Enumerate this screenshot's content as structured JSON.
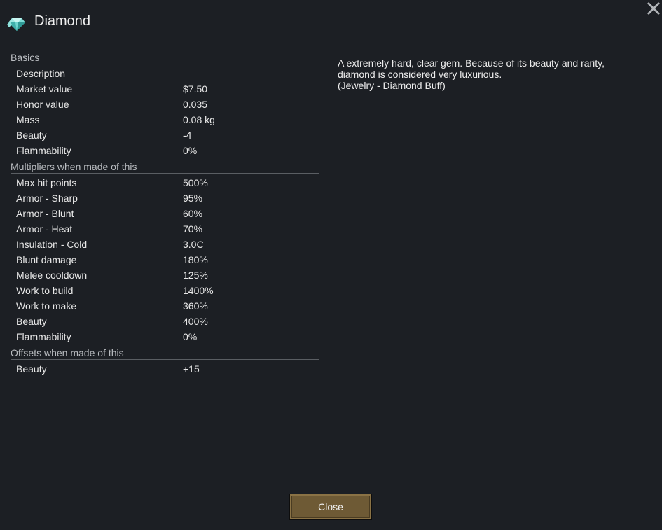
{
  "window": {
    "title": "Diamond",
    "title_icon": "diamond-gem-icon",
    "close_icon": "close-icon"
  },
  "basics": {
    "header": "Basics",
    "rows": [
      {
        "label": "Description",
        "value": ""
      },
      {
        "label": "Market value",
        "value": "$7.50"
      },
      {
        "label": "Honor value",
        "value": "0.035"
      },
      {
        "label": "Mass",
        "value": "0.08 kg"
      },
      {
        "label": "Beauty",
        "value": "-4"
      },
      {
        "label": "Flammability",
        "value": "0%"
      }
    ]
  },
  "multipliers": {
    "header": "Multipliers when made of this",
    "rows": [
      {
        "label": "Max hit points",
        "value": "500%"
      },
      {
        "label": "Armor - Sharp",
        "value": "95%"
      },
      {
        "label": "Armor - Blunt",
        "value": "60%"
      },
      {
        "label": "Armor - Heat",
        "value": "70%"
      },
      {
        "label": "Insulation - Cold",
        "value": "3.0C"
      },
      {
        "label": "Blunt damage",
        "value": "180%"
      },
      {
        "label": "Melee cooldown",
        "value": "125%"
      },
      {
        "label": "Work to build",
        "value": "1400%"
      },
      {
        "label": "Work to make",
        "value": "360%"
      },
      {
        "label": "Beauty",
        "value": "400%"
      },
      {
        "label": "Flammability",
        "value": "0%"
      }
    ]
  },
  "offsets": {
    "header": "Offsets when made of this",
    "rows": [
      {
        "label": "Beauty",
        "value": "+15"
      }
    ]
  },
  "description": {
    "lines": [
      "A extremely hard, clear gem. Because of its beauty and rarity,",
      "diamond is considered very luxurious.",
      "(Jewelry - Diamond Buff)"
    ]
  },
  "footer": {
    "close_label": "Close"
  },
  "colors": {
    "background": "#1c1f24",
    "button": "#6e5a35",
    "gem": "#6fd6d0"
  }
}
